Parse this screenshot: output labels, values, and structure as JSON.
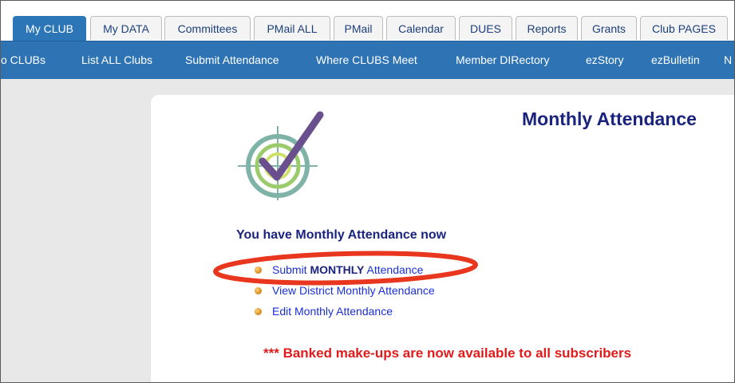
{
  "tabs": [
    {
      "label": "My CLUB",
      "active": true
    },
    {
      "label": "My DATA"
    },
    {
      "label": "Committees"
    },
    {
      "label": "PMail ALL"
    },
    {
      "label": "PMail"
    },
    {
      "label": "Calendar"
    },
    {
      "label": "DUES"
    },
    {
      "label": "Reports"
    },
    {
      "label": "Grants"
    },
    {
      "label": "Club PAGES"
    }
  ],
  "subnav": [
    "o CLUBs",
    "List ALL Clubs",
    "Submit Attendance",
    "Where CLUBS Meet",
    "Member DIRectory",
    "ezStory",
    "ezBulletin",
    "N"
  ],
  "main": {
    "title": "Monthly Attendance",
    "section_heading": "You have Monthly Attendance now",
    "links": {
      "submit_prefix": "Submit ",
      "submit_bold": "MONTHLY",
      "submit_suffix": " Attendance",
      "view": "View District Monthly Attendance",
      "edit": "Edit Monthly Attendance"
    },
    "notice": "*** Banked make-ups are now available to all subscribers"
  },
  "colors": {
    "tab_active": "#2c76b8",
    "subnav_bg": "#2e74b5",
    "title": "#1a237e",
    "link": "#1a2fd6",
    "notice": "#e01b1b",
    "highlight": "#e8361f"
  },
  "icons": {
    "logo": "target-checkmark-icon",
    "bullet": "bullet-icon"
  }
}
